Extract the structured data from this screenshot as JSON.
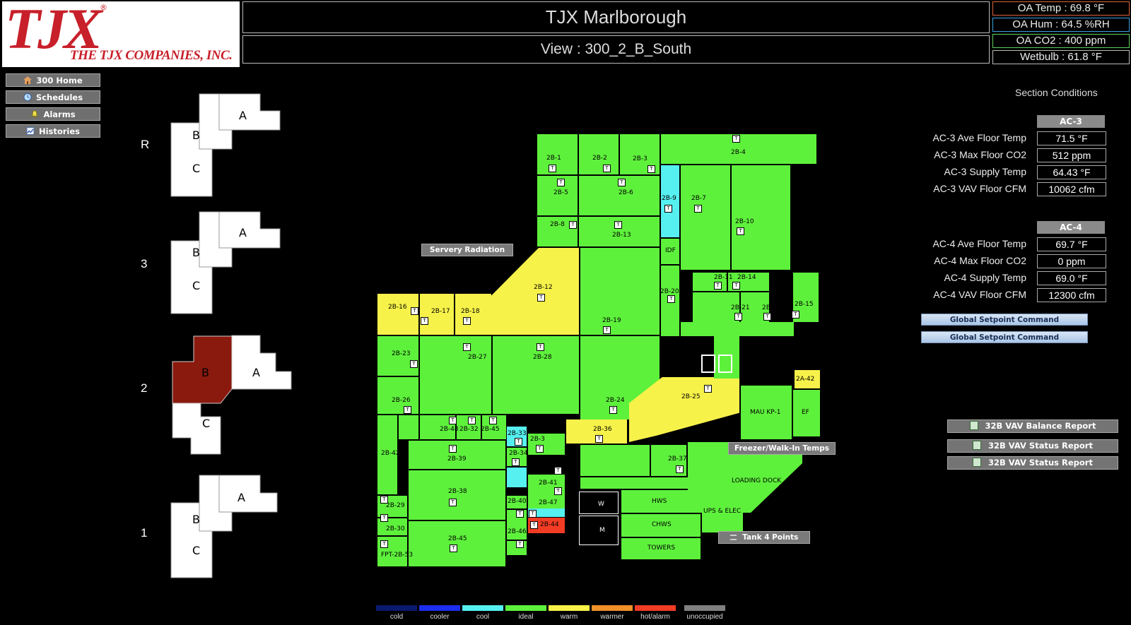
{
  "logo": {
    "mark": "TJX",
    "company": "THE TJX COMPANIES, INC.",
    "registered": "®"
  },
  "header": {
    "title": "TJX Marlborough",
    "view": "View : 300_2_B_South"
  },
  "outside_air": {
    "temp": "OA Temp : 69.8 °F",
    "hum": "OA Hum : 64.5 %RH",
    "co2": "OA CO2 : 400 ppm",
    "wetbulb": "Wetbulb : 61.8 °F",
    "temp_color": "#e0623a",
    "hum_color": "#3fa0e0",
    "co2_color": "#5ed05e"
  },
  "nav": [
    {
      "label": "300 Home",
      "icon": "home-icon"
    },
    {
      "label": "Schedules",
      "icon": "clock-icon"
    },
    {
      "label": "Alarms",
      "icon": "bell-icon"
    },
    {
      "label": "Histories",
      "icon": "chart-icon"
    }
  ],
  "floors": {
    "r": {
      "label": "R",
      "a": "A",
      "b": "B",
      "c": "C"
    },
    "f3": {
      "label": "3",
      "a": "A",
      "b": "B",
      "c": "C"
    },
    "f2": {
      "label": "2",
      "a": "A",
      "b": "B",
      "c": "C",
      "selected": "B",
      "selected_color": "#8b1a0e"
    },
    "f1": {
      "label": "1",
      "a": "A",
      "b": "B",
      "c": "C"
    }
  },
  "conditions": {
    "title": "Section Conditions",
    "ac3": {
      "header": "AC-3",
      "rows": [
        {
          "label": "AC-3 Ave Floor Temp",
          "value": "71.5 °F"
        },
        {
          "label": "AC-3 Max Floor CO2",
          "value": "512 ppm"
        },
        {
          "label": "AC-3 Supply Temp",
          "value": "64.43 °F"
        },
        {
          "label": "AC-3 VAV Floor CFM",
          "value": "10062 cfm"
        }
      ]
    },
    "ac4": {
      "header": "AC-4",
      "rows": [
        {
          "label": "AC-4 Ave Floor Temp",
          "value": "69.7 °F"
        },
        {
          "label": "AC-4 Max Floor CO2",
          "value": "0 ppm"
        },
        {
          "label": "AC-4 Supply Temp",
          "value": "69.0 °F"
        },
        {
          "label": "AC-4 VAV Floor CFM",
          "value": "12300 cfm"
        }
      ]
    },
    "setpoint_buttons": [
      "Global Setpoint Command",
      "Global Setpoint Command"
    ]
  },
  "reports": [
    "32B VAV Balance Report",
    "32B VAV Status Report",
    "32B VAV Status Report"
  ],
  "floorplan": {
    "buttons": {
      "servery": "Servery Radiation",
      "freezer": "Freezer/Walk-In Temps",
      "tank": "Tank 4 Points"
    },
    "thermostat_glyph": "T",
    "rooms": {
      "r1": "2B-1",
      "r2": "2B-2",
      "r3": "2B-3",
      "r4": "2B-4",
      "r5": "2B-5",
      "r6": "2B-6",
      "r7": "2B-7",
      "r8": "2B-8",
      "r9": "2B-9",
      "r10": "2B-10",
      "r11": "2B-11",
      "r12": "2B-12",
      "r13": "2B-13",
      "r14": "2B-14",
      "r15": "2B-15",
      "r16": "2B-16",
      "r17": "2B-17",
      "r18": "2B-18",
      "r19": "2B-19",
      "r20": "2B-20",
      "r21": "2B-21",
      "r22": "2B-22",
      "r23": "2B-23",
      "r24": "2B-24",
      "r25": "2B-25",
      "r26": "2B-26",
      "r27": "2B-27",
      "r28": "2B-28",
      "r29": "2B-29",
      "r30": "2B-30",
      "r32": "2B-32",
      "r33": "2B-33",
      "r34": "2B-34",
      "r35": "2B-3",
      "r36": "2B-36",
      "r37": "2B-37",
      "r38": "2B-38",
      "r39": "2B-39",
      "r40": "2B-40",
      "r41": "2B-41",
      "r42": "2B-42",
      "r44": "2B-44",
      "r45": "2B-45",
      "r46": "2B-46",
      "r47": "2B-47",
      "r48": "2B-48",
      "r49": "2B-45",
      "fpt": "FPT-2B-53",
      "a42": "2A-42",
      "idf": "IDF",
      "mau": "MAU KP-1",
      "ef": "EF",
      "loading": "LOADING DOCK",
      "ups": "UPS & ELEC",
      "hws": "HWS",
      "chws": "CHWS",
      "towers": "TOWERS",
      "w": "W",
      "m": "M"
    }
  },
  "legend": [
    {
      "label": "cold",
      "color": "#0a1a6e"
    },
    {
      "label": "cooler",
      "color": "#1c2ef0"
    },
    {
      "label": "cool",
      "color": "#56f0f0"
    },
    {
      "label": "ideal",
      "color": "#5ef13c"
    },
    {
      "label": "warm",
      "color": "#f7f24a"
    },
    {
      "label": "warmer",
      "color": "#f0902a"
    },
    {
      "label": "hot/alarm",
      "color": "#f23c24"
    },
    {
      "label": "unoccupied",
      "color": "#808080"
    }
  ]
}
